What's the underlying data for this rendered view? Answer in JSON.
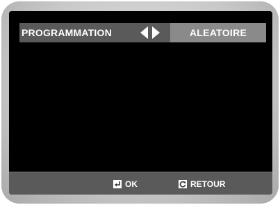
{
  "header": {
    "title": "PROGRAMMATION",
    "value": "ALEATOIRE",
    "left_arrow_icon": "triangle-left-icon",
    "right_arrow_icon": "triangle-right-icon"
  },
  "footer": {
    "ok_label": "OK",
    "ok_icon": "enter-icon",
    "back_label": "RETOUR",
    "back_icon": "return-icon"
  },
  "colors": {
    "bar": "#5a5a5a",
    "value_box": "#8a8a8a",
    "screen": "#000000",
    "text": "#ffffff"
  }
}
